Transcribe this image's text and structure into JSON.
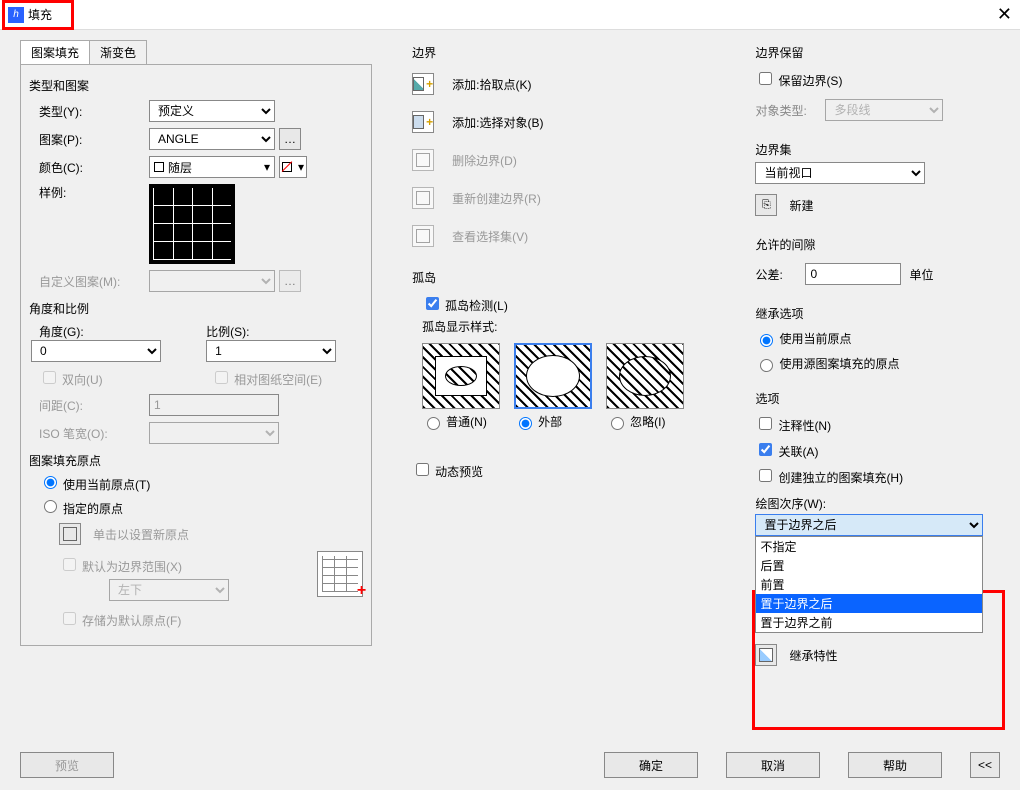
{
  "title": "填充",
  "tabs": {
    "hatch": "图案填充",
    "gradient": "渐变色"
  },
  "type_pattern": {
    "group": "类型和图案",
    "type_label": "类型(Y):",
    "type_value": "预定义",
    "pattern_label": "图案(P):",
    "pattern_value": "ANGLE",
    "color_label": "颜色(C):",
    "color_value": "随层",
    "sample_label": "样例:",
    "custom_label": "自定义图案(M):"
  },
  "angle_scale": {
    "group": "角度和比例",
    "angle_label": "角度(G):",
    "angle_value": "0",
    "scale_label": "比例(S):",
    "scale_value": "1",
    "double_label": "双向(U)",
    "relative_label": "相对图纸空间(E)",
    "spacing_label": "间距(C):",
    "spacing_value": "1",
    "iso_label": "ISO 笔宽(O):"
  },
  "origin": {
    "group": "图案填充原点",
    "use_current": "使用当前原点(T)",
    "specify": "指定的原点",
    "click_new": "单击以设置新原点",
    "default_bounds": "默认为边界范围(X)",
    "pos_value": "左下",
    "store_default": "存储为默认原点(F)"
  },
  "boundary": {
    "group": "边界",
    "pick": "添加:拾取点(K)",
    "select": "添加:选择对象(B)",
    "delete": "删除边界(D)",
    "recreate": "重新创建边界(R)",
    "view": "查看选择集(V)"
  },
  "islands": {
    "group": "孤岛",
    "detect": "孤岛检测(L)",
    "style": "孤岛显示样式:",
    "normal": "普通(N)",
    "outer": "外部",
    "ignore": "忽略(I)"
  },
  "dynamic_preview": "动态预览",
  "retain": {
    "group": "边界保留",
    "retain_label": "保留边界(S)",
    "objtype_label": "对象类型:",
    "objtype_value": "多段线"
  },
  "bset": {
    "group": "边界集",
    "value": "当前视口",
    "new_btn": "新建"
  },
  "gap": {
    "group": "允许的间隙",
    "tol_label": "公差:",
    "tol_value": "0",
    "unit_label": "单位"
  },
  "inherit": {
    "group": "继承选项",
    "current": "使用当前原点",
    "source": "使用源图案填充的原点"
  },
  "options": {
    "group": "选项",
    "annotative": "注释性(N)",
    "assoc": "关联(A)",
    "separate": "创建独立的图案填充(H)",
    "draw_order_label": "绘图次序(W):",
    "draw_order_value": "置于边界之后",
    "draw_order_opts": [
      "不指定",
      "后置",
      "前置",
      "置于边界之后",
      "置于边界之前"
    ]
  },
  "inherit_props": "继承特性",
  "buttons": {
    "preview": "预览",
    "ok": "确定",
    "cancel": "取消",
    "help": "帮助"
  }
}
